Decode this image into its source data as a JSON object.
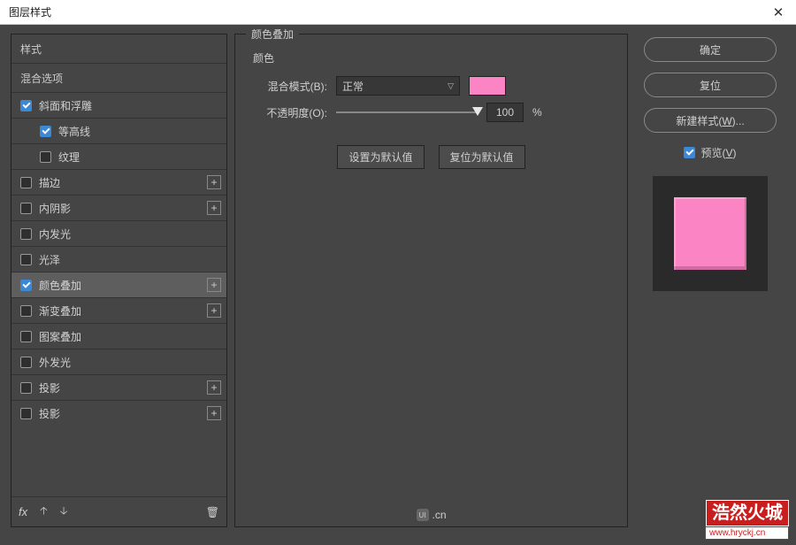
{
  "window": {
    "title": "图层样式"
  },
  "sidebar": {
    "heading1": "样式",
    "heading2": "混合选项",
    "items": [
      {
        "label": "斜面和浮雕",
        "checked": true,
        "plus": false,
        "sub": false
      },
      {
        "label": "等高线",
        "checked": true,
        "plus": false,
        "sub": true
      },
      {
        "label": "纹理",
        "checked": false,
        "plus": false,
        "sub": true
      },
      {
        "label": "描边",
        "checked": false,
        "plus": true,
        "sub": false
      },
      {
        "label": "内阴影",
        "checked": false,
        "plus": true,
        "sub": false
      },
      {
        "label": "内发光",
        "checked": false,
        "plus": false,
        "sub": false
      },
      {
        "label": "光泽",
        "checked": false,
        "plus": false,
        "sub": false
      },
      {
        "label": "颜色叠加",
        "checked": true,
        "plus": true,
        "sub": false,
        "selected": true
      },
      {
        "label": "渐变叠加",
        "checked": false,
        "plus": true,
        "sub": false
      },
      {
        "label": "图案叠加",
        "checked": false,
        "plus": false,
        "sub": false
      },
      {
        "label": "外发光",
        "checked": false,
        "plus": false,
        "sub": false
      },
      {
        "label": "投影",
        "checked": false,
        "plus": true,
        "sub": false
      },
      {
        "label": "投影",
        "checked": false,
        "plus": true,
        "sub": false
      }
    ],
    "footer_fx": "fx"
  },
  "panel": {
    "title": "颜色叠加",
    "subtitle": "颜色",
    "blend_label": "混合模式(B):",
    "blend_value": "正常",
    "opacity_label": "不透明度(O):",
    "opacity_value": "100",
    "opacity_unit": "%",
    "swatch_color": "#fa84c4",
    "make_default": "设置为默认值",
    "reset_default": "复位为默认值"
  },
  "right": {
    "ok": "确定",
    "cancel": "复位",
    "new_style": "新建样式(W)...",
    "preview": "预览(V)",
    "preview_underline": "V"
  },
  "watermark": {
    "brand": "浩然火城",
    "url": "www.hryckj.cn"
  },
  "footer_badge": ".cn"
}
